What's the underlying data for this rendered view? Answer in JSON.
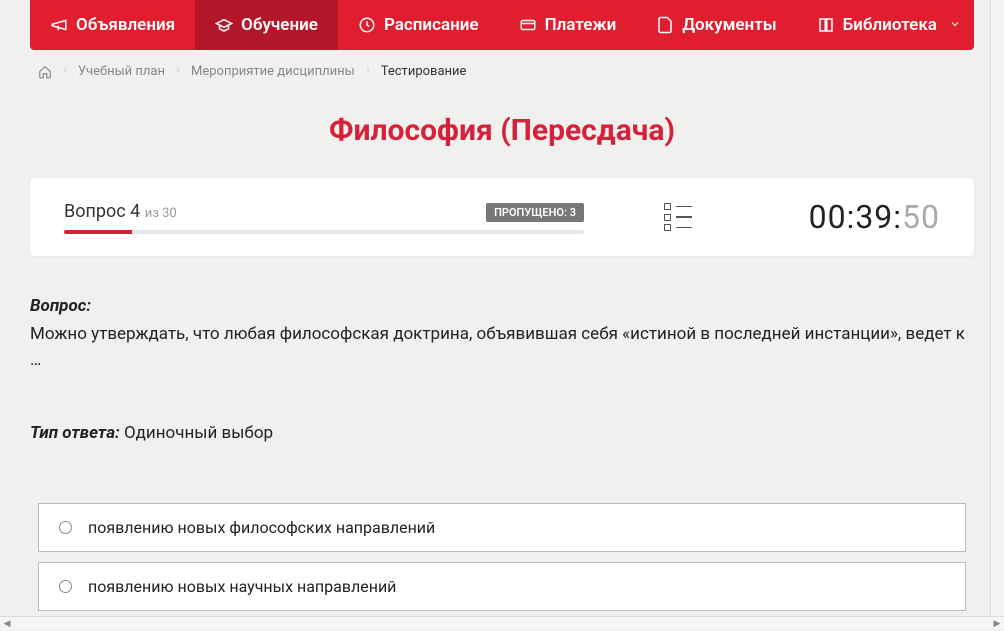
{
  "nav": {
    "items": [
      {
        "label": "Объявления",
        "icon": "megaphone",
        "active": false
      },
      {
        "label": "Обучение",
        "icon": "graduation-cap",
        "active": true
      },
      {
        "label": "Расписание",
        "icon": "clock",
        "active": false
      },
      {
        "label": "Платежи",
        "icon": "card",
        "active": false
      },
      {
        "label": "Документы",
        "icon": "document",
        "active": false
      },
      {
        "label": "Библиотека",
        "icon": "book",
        "active": false,
        "dropdown": true
      }
    ]
  },
  "breadcrumb": {
    "items": [
      {
        "label": "Учебный план"
      },
      {
        "label": "Мероприятие дисциплины"
      }
    ],
    "current": "Тестирование"
  },
  "page_title": "Философия (Пересдача)",
  "panel": {
    "question_label": "Вопрос",
    "question_number": "4",
    "of_label": "из",
    "total": "30",
    "skipped_label": "ПРОПУЩЕНО:",
    "skipped_count": "3",
    "progress_percent": 13,
    "timer_main": "00:39:",
    "timer_seconds": "50"
  },
  "question": {
    "label": "Вопрос:",
    "text": "Можно утверждать, что любая философская доктрина, объявившая себя «истиной в последней инстанции», ведет к …"
  },
  "answer_type": {
    "label": "Тип ответа:",
    "value": "Одиночный выбор"
  },
  "answers": [
    {
      "text": "появлению новых философских направлений"
    },
    {
      "text": "появлению новых научных направлений"
    }
  ]
}
